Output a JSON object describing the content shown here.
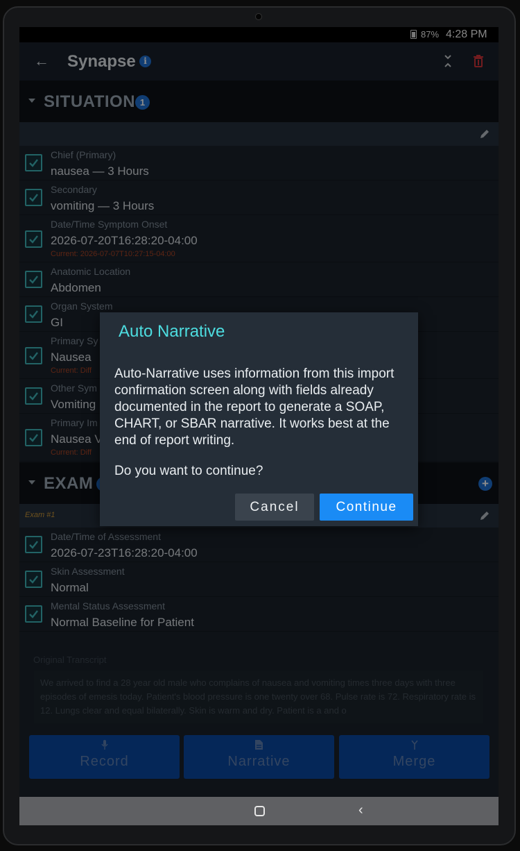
{
  "status_bar": {
    "battery": "87%",
    "time": "4:28 PM"
  },
  "app_bar": {
    "title": "Synapse",
    "info_glyph": "i"
  },
  "situation": {
    "title": "SITUATION",
    "count": "1",
    "rows": [
      {
        "label": "Chief (Primary)",
        "value": "nausea — 3 Hours",
        "current": ""
      },
      {
        "label": "Secondary",
        "value": "vomiting — 3 Hours",
        "current": ""
      },
      {
        "label": "Date/Time Symptom Onset",
        "value": "2026-07-20T16:28:20-04:00",
        "current": "Current: 2026-07-07T10:27:15-04:00"
      },
      {
        "label": "Anatomic Location",
        "value": "Abdomen",
        "current": ""
      },
      {
        "label": "Organ System",
        "value": "GI",
        "current": ""
      },
      {
        "label": "Primary Sy",
        "value": "Nausea",
        "current": "Current: Diff"
      },
      {
        "label": "Other Sym",
        "value": "Vomiting",
        "current": ""
      },
      {
        "label": "Primary Im",
        "value": "Nausea V",
        "current": "Current: Diff"
      }
    ]
  },
  "exam": {
    "title": "EXAM",
    "exam_label": "Exam #1",
    "rows": [
      {
        "label": "Date/Time of Assessment",
        "value": "2026-07-23T16:28:20-04:00"
      },
      {
        "label": "Skin Assessment",
        "value": "Normal"
      },
      {
        "label": "Mental Status Assessment",
        "value": "Normal Baseline for Patient"
      }
    ]
  },
  "transcript": {
    "label": "Original Transcript",
    "text": "We arrived to find a 28 year old male who complains of nausea and vomiting times three days with three episodes of emesis today. Patient's blood pressure is one twenty over 68. Pulse rate is 72. Respiratory rate is 12. Lungs clear and equal bilaterally. Skin is warm and dry. Patient is a and o"
  },
  "actions": {
    "record": "Record",
    "narrative": "Narrative",
    "merge": "Merge"
  },
  "dialog": {
    "title": "Auto Narrative",
    "body": "Auto-Narrative uses information from this import confirmation screen along with fields already documented in the report to generate a SOAP, CHART, or SBAR narrative. It works best at the end of report writing.",
    "question": "Do you want to continue?",
    "cancel": "Cancel",
    "continue": "Continue"
  },
  "colors": {
    "accent": "#1a8bf5",
    "dialog_title": "#4ddde0",
    "check": "#3fb4b8",
    "warning": "#a94425"
  },
  "icons": [
    "back-arrow-icon",
    "info-icon",
    "collapse-icon",
    "trash-icon",
    "caret-down-icon",
    "edit-pencil-icon",
    "add-icon",
    "checkbox-icon",
    "microphone-icon",
    "document-icon",
    "merge-icon",
    "home-icon",
    "nav-back-icon"
  ]
}
